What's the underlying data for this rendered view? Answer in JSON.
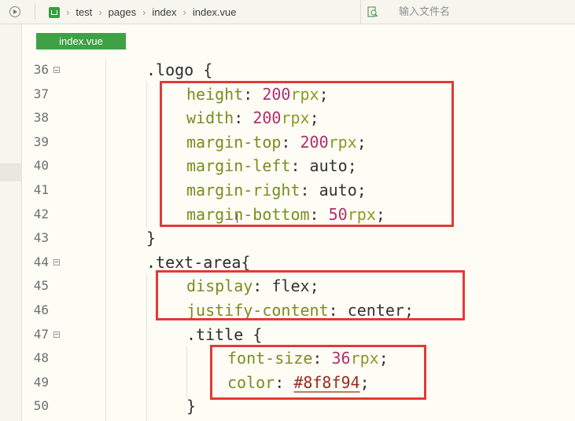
{
  "breadcrumb": {
    "items": [
      "test",
      "pages",
      "index",
      "index.vue"
    ]
  },
  "search": {
    "placeholder": "输入文件名"
  },
  "tab": {
    "label": "index.vue"
  },
  "code_lines": [
    {
      "num": "36",
      "foldable": true,
      "indent": 0,
      "tokens": [
        {
          "t": ".logo",
          "c": "sel"
        },
        {
          "t": " {",
          "c": "punc"
        }
      ]
    },
    {
      "num": "37",
      "foldable": false,
      "indent": 1,
      "tokens": [
        {
          "t": "height",
          "c": "prop"
        },
        {
          "t": ": ",
          "c": "punc"
        },
        {
          "t": "200",
          "c": "num"
        },
        {
          "t": "rpx",
          "c": "unit"
        },
        {
          "t": ";",
          "c": "punc"
        }
      ]
    },
    {
      "num": "38",
      "foldable": false,
      "indent": 1,
      "tokens": [
        {
          "t": "width",
          "c": "prop"
        },
        {
          "t": ": ",
          "c": "punc"
        },
        {
          "t": "200",
          "c": "num"
        },
        {
          "t": "rpx",
          "c": "unit"
        },
        {
          "t": ";",
          "c": "punc"
        }
      ]
    },
    {
      "num": "39",
      "foldable": false,
      "indent": 1,
      "tokens": [
        {
          "t": "margin-top",
          "c": "prop"
        },
        {
          "t": ": ",
          "c": "punc"
        },
        {
          "t": "200",
          "c": "num"
        },
        {
          "t": "rpx",
          "c": "unit"
        },
        {
          "t": ";",
          "c": "punc"
        }
      ]
    },
    {
      "num": "40",
      "foldable": false,
      "indent": 1,
      "tokens": [
        {
          "t": "margin-left",
          "c": "prop"
        },
        {
          "t": ": ",
          "c": "punc"
        },
        {
          "t": "auto",
          "c": "kw"
        },
        {
          "t": ";",
          "c": "punc"
        }
      ]
    },
    {
      "num": "41",
      "foldable": false,
      "indent": 1,
      "tokens": [
        {
          "t": "margin-right",
          "c": "prop"
        },
        {
          "t": ": ",
          "c": "punc"
        },
        {
          "t": "auto",
          "c": "kw"
        },
        {
          "t": ";",
          "c": "punc"
        }
      ]
    },
    {
      "num": "42",
      "foldable": false,
      "indent": 1,
      "tokens": [
        {
          "t": "margin-bottom",
          "c": "prop"
        },
        {
          "t": ": ",
          "c": "punc"
        },
        {
          "t": "50",
          "c": "num"
        },
        {
          "t": "rpx",
          "c": "unit"
        },
        {
          "t": ";",
          "c": "punc"
        }
      ]
    },
    {
      "num": "43",
      "foldable": false,
      "indent": 0,
      "tokens": [
        {
          "t": "}",
          "c": "punc"
        }
      ]
    },
    {
      "num": "44",
      "foldable": true,
      "indent": 0,
      "tokens": [
        {
          "t": ".text-area",
          "c": "sel"
        },
        {
          "t": "{",
          "c": "punc"
        }
      ]
    },
    {
      "num": "45",
      "foldable": false,
      "indent": 1,
      "tokens": [
        {
          "t": "display",
          "c": "prop"
        },
        {
          "t": ": ",
          "c": "punc"
        },
        {
          "t": "flex",
          "c": "kw"
        },
        {
          "t": ";",
          "c": "punc"
        }
      ]
    },
    {
      "num": "46",
      "foldable": false,
      "indent": 1,
      "tokens": [
        {
          "t": "justify-content",
          "c": "prop"
        },
        {
          "t": ": ",
          "c": "punc"
        },
        {
          "t": "center",
          "c": "kw"
        },
        {
          "t": ";",
          "c": "punc"
        }
      ]
    },
    {
      "num": "47",
      "foldable": true,
      "indent": 1,
      "tokens": [
        {
          "t": ".title",
          "c": "sel"
        },
        {
          "t": " {",
          "c": "punc"
        }
      ]
    },
    {
      "num": "48",
      "foldable": false,
      "indent": 2,
      "tokens": [
        {
          "t": "font-size",
          "c": "prop"
        },
        {
          "t": ": ",
          "c": "punc"
        },
        {
          "t": "36",
          "c": "num"
        },
        {
          "t": "rpx",
          "c": "unit"
        },
        {
          "t": ";",
          "c": "punc"
        }
      ]
    },
    {
      "num": "49",
      "foldable": false,
      "indent": 2,
      "tokens": [
        {
          "t": "color",
          "c": "prop"
        },
        {
          "t": ": ",
          "c": "punc"
        },
        {
          "t": "#8f8f94",
          "c": "hexv"
        },
        {
          "t": ";",
          "c": "punc"
        }
      ]
    },
    {
      "num": "50",
      "foldable": false,
      "indent": 1,
      "tokens": [
        {
          "t": "}",
          "c": "punc"
        }
      ]
    }
  ],
  "colors": {
    "tab_bg": "#3fa045",
    "highlight_box": "#e23a34",
    "selector_text": "#2c2c2c",
    "property_text": "#7a8c1f",
    "number_text": "#b0306c",
    "unit_text": "#8a9a26",
    "hex_value_text": "#9b2b1e"
  },
  "icons": {
    "run": "play-circle-icon",
    "project": "project-u-icon",
    "search": "file-search-icon",
    "fold": "fold-minus-icon"
  }
}
